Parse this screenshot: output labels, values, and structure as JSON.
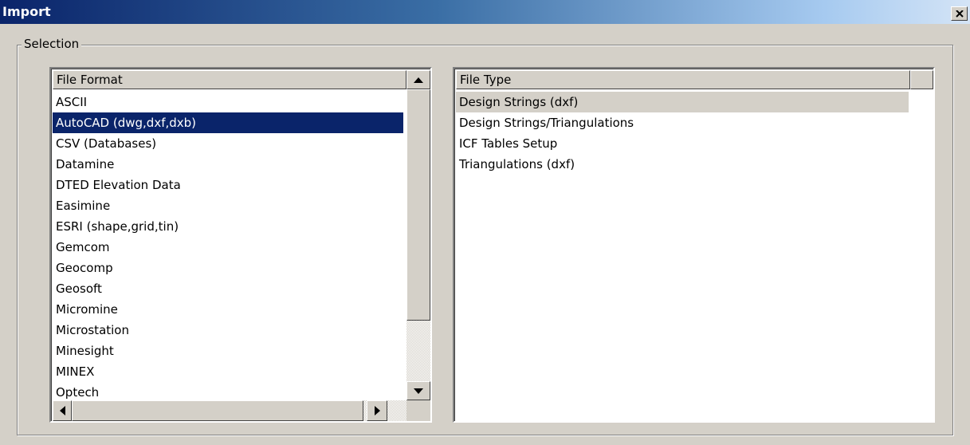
{
  "window": {
    "title": "Import",
    "close_glyph": "✕"
  },
  "group": {
    "label": "Selection"
  },
  "file_format_list": {
    "header": "File Format",
    "items": [
      "ASCII",
      "AutoCAD (dwg,dxf,dxb)",
      "CSV (Databases)",
      "Datamine",
      "DTED Elevation Data",
      "Easimine",
      "ESRI (shape,grid,tin)",
      "Gemcom",
      "Geocomp",
      "Geosoft",
      "Micromine",
      "Microstation",
      "Minesight",
      "MINEX",
      "Optech"
    ],
    "selected_item": "AutoCAD (dwg,dxf,dxb)"
  },
  "file_type_list": {
    "header": "File Type",
    "items": [
      "Design Strings (dxf)",
      "Design Strings/Triangulations",
      "ICF Tables Setup",
      "Triangulations (dxf)"
    ],
    "highlighted_item": "Design Strings (dxf)"
  },
  "icons": {
    "close": "close-icon",
    "scroll_up": "arrow-up-icon",
    "scroll_down": "arrow-down-icon",
    "scroll_left": "arrow-left-icon",
    "scroll_right": "arrow-right-icon"
  },
  "colors": {
    "selection": "#0a246a",
    "face": "#d4d0c8"
  }
}
